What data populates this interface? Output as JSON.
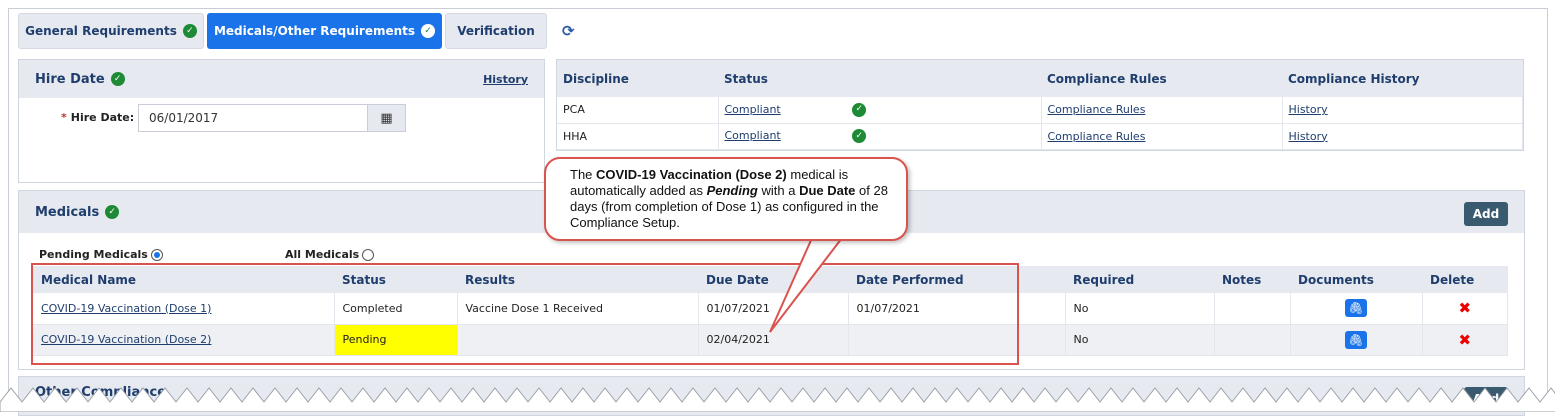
{
  "tabs": {
    "general": "General Requirements",
    "medicals": "Medicals/Other Requirements",
    "verification": "Verification"
  },
  "hire_date_panel": {
    "title": "Hire Date",
    "history_link": "History",
    "label": "Hire Date:",
    "required_mark": "*",
    "value": "06/01/2017"
  },
  "discipline_table": {
    "headers": [
      "Discipline",
      "Status",
      "Compliance Rules",
      "Compliance History"
    ],
    "rows": [
      {
        "discipline": "PCA",
        "status": "Compliant",
        "rules": "Compliance Rules",
        "history": "History"
      },
      {
        "discipline": "HHA",
        "status": "Compliant",
        "rules": "Compliance Rules",
        "history": "History"
      }
    ]
  },
  "medicals_panel": {
    "title": "Medicals",
    "add_label": "Add",
    "filters": {
      "pending": "Pending Medicals",
      "all": "All Medicals",
      "selected": "pending"
    },
    "headers": [
      "Medical Name",
      "Status",
      "Results",
      "Due Date",
      "Date Performed",
      "Required",
      "Notes",
      "Documents",
      "Delete"
    ],
    "rows": [
      {
        "name": "COVID-19 Vaccination (Dose 1)",
        "status": "Completed",
        "results": "Vaccine Dose 1 Received",
        "due": "01/07/2021",
        "performed": "01/07/2021",
        "required": "No",
        "notes": ""
      },
      {
        "name": "COVID-19 Vaccination (Dose 2)",
        "status": "Pending",
        "results": "",
        "due": "02/04/2021",
        "performed": "",
        "required": "No",
        "notes": ""
      }
    ]
  },
  "callout": {
    "t1": "The ",
    "b1": "COVID-19 Vaccination (Dose 2)",
    "t2": " medical is automatically added as ",
    "bi1": "Pending",
    "t3": " with a ",
    "b2": "Due Date",
    "t4": " of 28 days (from completion of Dose 1) as configured in the Compliance Setup."
  },
  "bottom_panel": {
    "title_partial": "Other Compliance",
    "add_label": "Add"
  },
  "colors": {
    "accent": "#1a73e8",
    "check_green": "#1e8a35",
    "pending_highlight": "#ffff00",
    "callout_border": "#d9534f"
  }
}
